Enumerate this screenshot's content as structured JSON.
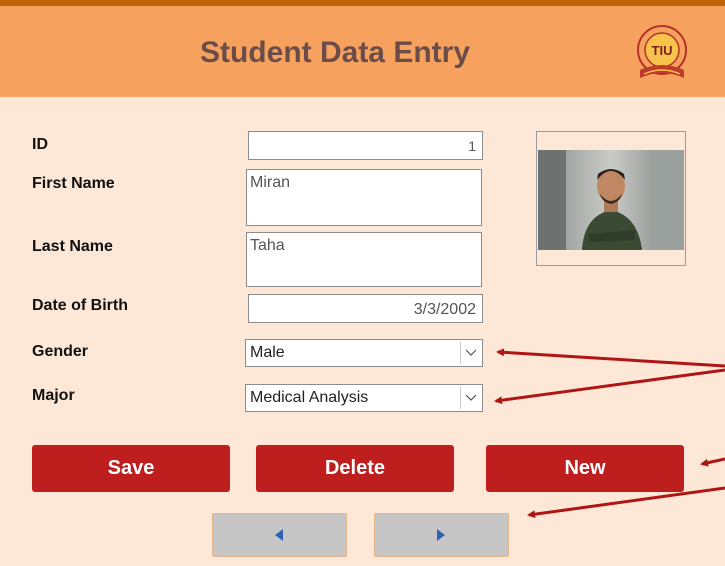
{
  "header": {
    "title": "Student Data Entry"
  },
  "form": {
    "id_label": "ID",
    "id_value": "1",
    "first_name_label": "First Name",
    "first_name_value": "Miran",
    "last_name_label": "Last Name",
    "last_name_value": "Taha",
    "dob_label": "Date of Birth",
    "dob_value": "3/3/2002",
    "gender_label": "Gender",
    "gender_value": "Male",
    "major_label": "Major",
    "major_value": "Medical Analysis"
  },
  "buttons": {
    "save": "Save",
    "delete": "Delete",
    "new": "New"
  },
  "icons": {
    "logo": "tiu-university-logo",
    "prev": "triangle-left-icon",
    "next": "triangle-right-icon",
    "dropdown": "chevron-down-icon"
  },
  "colors": {
    "header_bg": "#f6a25e",
    "page_bg": "#fde7d6",
    "button_red": "#be1e1e",
    "annotation_arrow": "#b01515"
  }
}
